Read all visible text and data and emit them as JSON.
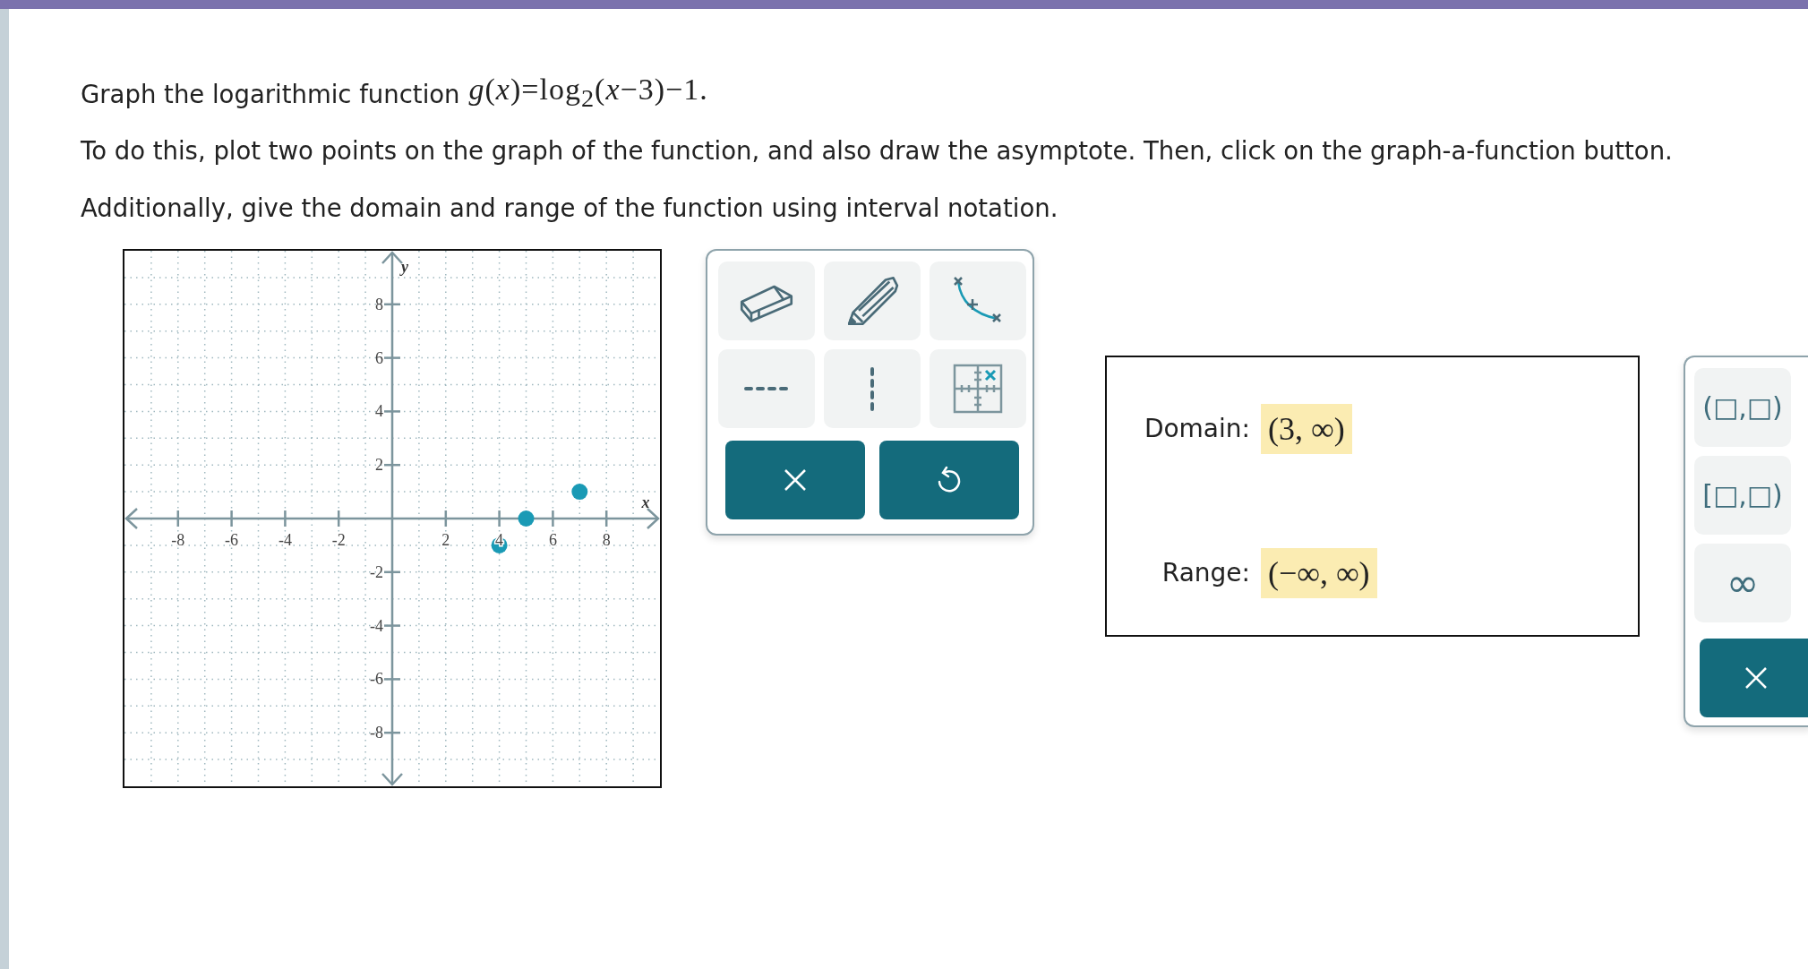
{
  "problem": {
    "intro": "Graph the logarithmic function",
    "formula": "*g*(*x*)=log$_{2}$(*x*−3)−1.",
    "lines": [
      "To do this, plot two points on the graph of the function, and also draw the asymptote. Then, click on the graph-a-function button.",
      "Additionally, give the domain and range of the function using interval notation."
    ]
  },
  "graph": {
    "chart_data": {
      "type": "scatter",
      "grid": true,
      "xlabel": "x",
      "ylabel": "y",
      "xlim": [
        -10,
        10
      ],
      "ylim": [
        -10,
        10
      ],
      "xticks": [
        -8,
        -6,
        -4,
        -2,
        2,
        4,
        6,
        8
      ],
      "yticks": [
        -8,
        -6,
        -4,
        -2,
        2,
        4,
        6,
        8
      ],
      "series": [
        {
          "color": "#1a9ab5",
          "x": [
            4,
            5,
            7
          ],
          "values": [
            -1,
            0,
            1
          ]
        }
      ]
    }
  },
  "answers": [
    {
      "label": "Domain:",
      "value": "(3, ∞)"
    },
    {
      "label": "Range:",
      "value": "(−∞, ∞)"
    }
  ],
  "keypad": [
    "(□,□)",
    "[□,□)",
    "∞"
  ]
}
